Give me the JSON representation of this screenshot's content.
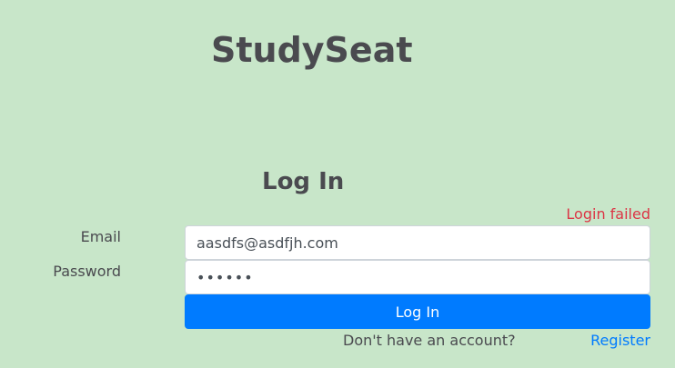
{
  "app": {
    "title": "StudySeat"
  },
  "form": {
    "title": "Log In",
    "error": "Login failed",
    "email_label": "Email",
    "email_value": "aasdfs@asdfjh.com",
    "password_label": "Password",
    "password_value": "••••••",
    "submit_label": "Log In",
    "account_prompt": "Don't have an account?",
    "register_link": "Register"
  },
  "colors": {
    "background": "#c8e6c9",
    "primary": "#007bff",
    "error": "#dc3545",
    "text": "#4a4a4f"
  }
}
